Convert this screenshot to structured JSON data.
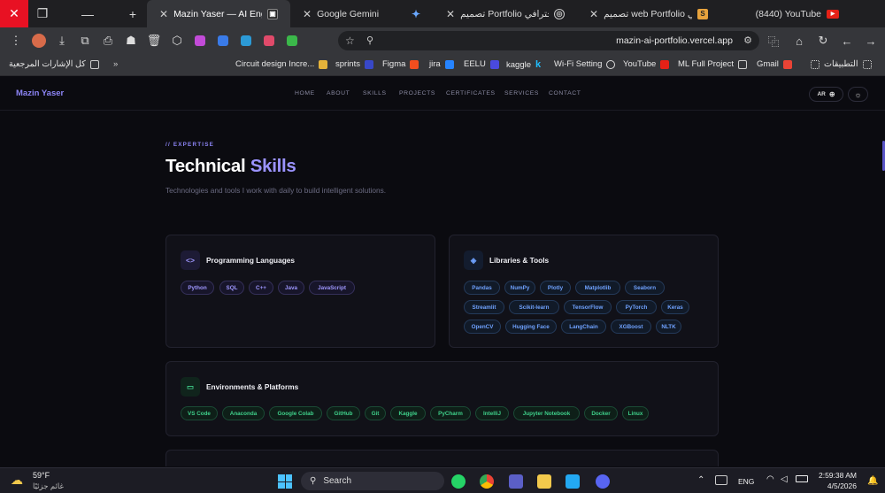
{
  "browser": {
    "tabs": [
      {
        "label": "Mazin Yaser — AI Engineer",
        "active": true
      },
      {
        "label": "Google Gemini"
      },
      {
        "label": "تصميم Portfolio احترافي"
      },
      {
        "label": "تصميم web Portfolio احترافي"
      },
      {
        "label": "(8440) YouTube"
      }
    ],
    "url": "mazin-ai-portfolio.vercel.app"
  },
  "bookmarks": [
    {
      "label": "كل الإشارات المرجعية"
    },
    {
      "label": "Circuit design Incre..."
    },
    {
      "label": "sprints"
    },
    {
      "label": "Figma"
    },
    {
      "label": "jira"
    },
    {
      "label": "EELU"
    },
    {
      "label": "kaggle"
    },
    {
      "label": "Wi-Fi Setting"
    },
    {
      "label": "YouTube"
    },
    {
      "label": "ML Full Project"
    },
    {
      "label": "Gmail"
    },
    {
      "label": "التطبيقات"
    }
  ],
  "site": {
    "brand": "Mazin Yaser",
    "nav": [
      "HOME",
      "ABOUT",
      "SKILLS",
      "PROJECTS",
      "CERTIFICATES",
      "SERVICES",
      "CONTACT"
    ],
    "lang_toggle": "AR",
    "eyebrow": "// EXPERTISE",
    "title_main": "Technical ",
    "title_accent": "Skills",
    "subtitle": "Technologies and tools I work with daily to build intelligent solutions.",
    "cards": [
      {
        "title": "Programming Languages",
        "icon": "code-icon",
        "color": "#9f97ff",
        "chips": [
          "Python",
          "SQL",
          "C++",
          "Java",
          "JavaScript"
        ]
      },
      {
        "title": "Libraries & Tools",
        "icon": "layers-icon",
        "color": "#6fa2ff",
        "chips": [
          "Pandas",
          "NumPy",
          "Plotly",
          "Matplotlib",
          "Seaborn",
          "Streamlit",
          "Scikit-learn",
          "TensorFlow",
          "PyTorch",
          "Keras",
          "OpenCV",
          "Hugging Face",
          "LangChain",
          "XGBoost",
          "NLTK"
        ]
      },
      {
        "title": "Environments & Platforms",
        "icon": "monitor-icon",
        "color": "#3fd08a",
        "chips": [
          "VS Code",
          "Anaconda",
          "Google Colab",
          "GitHub",
          "Git",
          "Kaggle",
          "PyCharm",
          "IntelliJ",
          "Jupyter Notebook",
          "Docker",
          "Linux"
        ]
      }
    ]
  },
  "taskbar": {
    "weather_temp": "59°F",
    "weather_desc": "غائم جزئيًا",
    "search_label": "Search",
    "lang": "ENG",
    "time": "2:59:38 AM",
    "date": "4/5/2026"
  },
  "colors": {
    "accent": "#8c84f5",
    "background": "#0b0b10",
    "card": "#111118"
  }
}
